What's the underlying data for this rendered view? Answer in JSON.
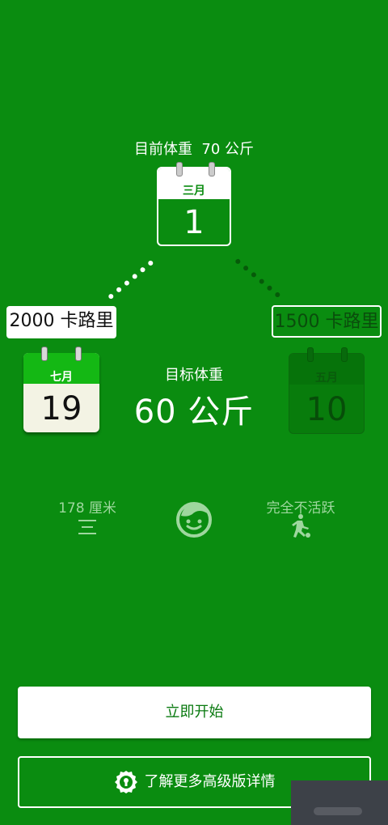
{
  "current": {
    "label": "目前体重",
    "value": "70 公斤",
    "month": "三月",
    "day": "1"
  },
  "target_date": {
    "month": "七月",
    "day": "19",
    "calories": "2000 卡路里"
  },
  "alt_date": {
    "month": "五月",
    "day": "10",
    "calories": "1500 卡路里"
  },
  "target": {
    "label": "目标体重",
    "value": "60 公斤"
  },
  "stats": {
    "height": "178 厘米",
    "activity": "完全不活跃"
  },
  "buttons": {
    "start": "立即开始",
    "premium": "了解更多高级版详情"
  },
  "colors": {
    "background": "#0a8c10",
    "calendar_green": "#14b814",
    "muted_text": "#9ed79e"
  },
  "icons": [
    "ruler-icon",
    "face-icon",
    "running-icon",
    "keyhole-badge-icon"
  ]
}
